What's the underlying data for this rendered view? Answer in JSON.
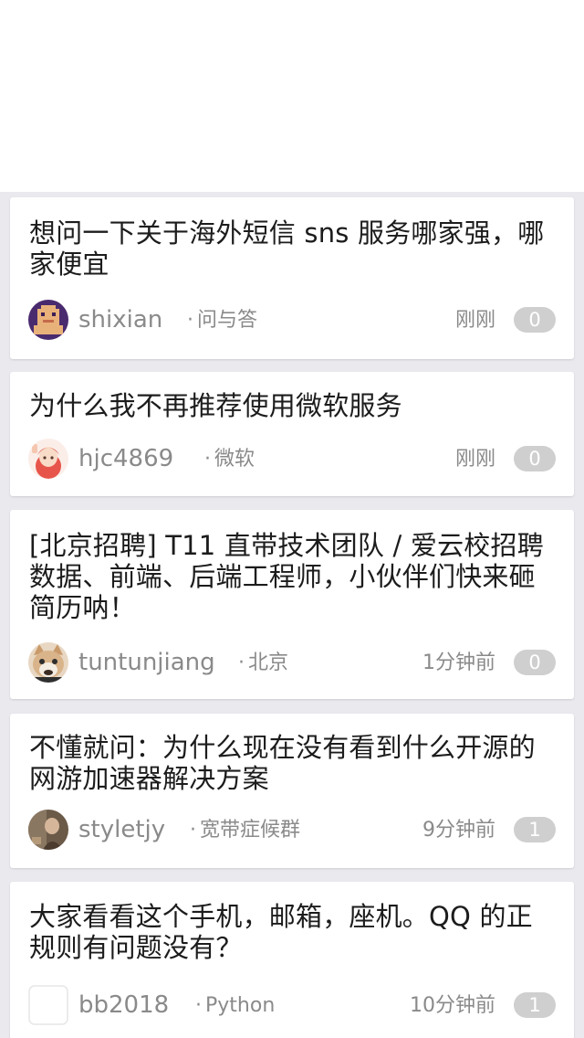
{
  "topics": [
    {
      "title": "想问一下关于海外短信 sns 服务哪家强，哪家便宜",
      "username": "shixian",
      "node": "问与答",
      "time": "刚刚",
      "replies": "0",
      "avatar_icon": "pixel-character-avatar"
    },
    {
      "title": "为什么我不再推荐使用微软服务",
      "username": "hjc4869",
      "node": "微软",
      "time": "刚刚",
      "replies": "0",
      "avatar_icon": "anime-girl-avatar"
    },
    {
      "title": "[北京招聘] T11 直带技术团队 / 爱云校招聘数据、前端、后端工程师，小伙伴们快来砸简历呐！",
      "username": "tuntunjiang",
      "node": "北京",
      "time": "1分钟前",
      "replies": "0",
      "avatar_icon": "cat-avatar"
    },
    {
      "title": "不懂就问：为什么现在没有看到什么开源的网游加速器解决方案",
      "username": "styletjy",
      "node": "宽带症候群",
      "time": "9分钟前",
      "replies": "1",
      "avatar_icon": "photo-avatar"
    },
    {
      "title": "大家看看这个手机，邮箱，座机。QQ 的正规则有问题没有？",
      "username": "bb2018",
      "node": "Python",
      "time": "10分钟前",
      "replies": "1",
      "avatar_icon": "blank-avatar"
    }
  ],
  "node_separator": "·"
}
